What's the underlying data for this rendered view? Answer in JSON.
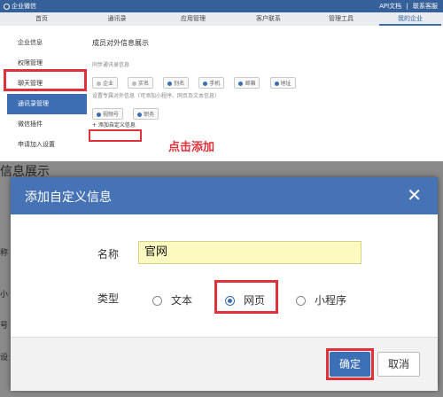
{
  "topbar": {
    "brand": "企业微信",
    "links": [
      "API文档",
      "|",
      "联系客服"
    ]
  },
  "tabs": [
    "首页",
    "通讯录",
    "应用管理",
    "客户联系",
    "管理工具",
    "我的企业"
  ],
  "sidebar": {
    "items": [
      "企业信息",
      "权限管理",
      "聊天管理",
      "通讯录管理",
      "微信插件",
      "申请加入设置"
    ],
    "active_index": 3
  },
  "content": {
    "title": "成员对外信息展示",
    "sync_label": "同步通讯录信息",
    "sync_fields": [
      "企业",
      "实名",
      "别名",
      "手机",
      "邮箱",
      "地址"
    ],
    "custom_label": "设置专属对外信息（可添加小程序、网页及文本信息）",
    "custom_fields": [
      "视频号",
      "职务"
    ],
    "add_link": "+ 添加自定义信息"
  },
  "annotation": "点击添加",
  "background": {
    "title": "信息展示",
    "edge_glyphs": [
      "称",
      "小",
      "号",
      "设"
    ]
  },
  "dialog": {
    "title": "添加自定义信息",
    "close": "✕",
    "name_label": "名称",
    "name_value": "官网",
    "type_label": "类型",
    "types": [
      "文本",
      "网页",
      "小程序"
    ],
    "selected_type_index": 1,
    "ok": "确定",
    "cancel": "取消"
  },
  "colors": {
    "primary": "#3b6fb6",
    "highlight": "#e0323b",
    "input_bg": "#fbfbc0"
  }
}
